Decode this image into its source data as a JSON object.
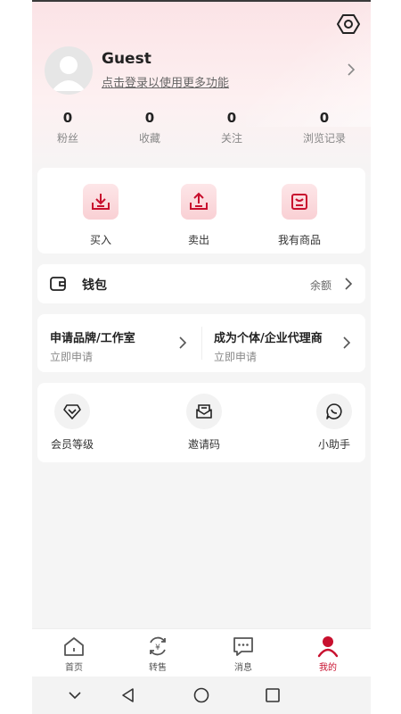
{
  "profile": {
    "username": "Guest",
    "login_prompt": "点击登录以使用更多功能"
  },
  "stats": [
    {
      "value": "0",
      "label": "粉丝"
    },
    {
      "value": "0",
      "label": "收藏"
    },
    {
      "value": "0",
      "label": "关注"
    },
    {
      "value": "0",
      "label": "浏览记录"
    }
  ],
  "trade": [
    {
      "label": "买入",
      "icon": "download-tray-icon"
    },
    {
      "label": "卖出",
      "icon": "upload-tray-icon"
    },
    {
      "label": "我有商品",
      "icon": "product-box-icon"
    }
  ],
  "wallet": {
    "label": "钱包",
    "balance_label": "余额",
    "icon": "wallet-icon"
  },
  "apply": [
    {
      "title": "申请品牌/工作室",
      "subtitle": "立即申请"
    },
    {
      "title": "成为个体/企业代理商",
      "subtitle": "立即申请"
    }
  ],
  "tools": [
    {
      "label": "会员等级",
      "icon": "diamond-icon"
    },
    {
      "label": "邀请码",
      "icon": "envelope-icon"
    },
    {
      "label": "小助手",
      "icon": "chat-bubble-icon"
    }
  ],
  "tabs": [
    {
      "label": "首页",
      "icon": "home-icon"
    },
    {
      "label": "转售",
      "icon": "yuan-cycle-icon"
    },
    {
      "label": "消息",
      "icon": "message-icon"
    },
    {
      "label": "我的",
      "icon": "person-icon",
      "active": true
    }
  ],
  "colors": {
    "accent": "#c8102e",
    "header_gradient_top": "#fbe3e6",
    "card_bg": "#ffffff",
    "page_bg": "#f5f5f5"
  }
}
